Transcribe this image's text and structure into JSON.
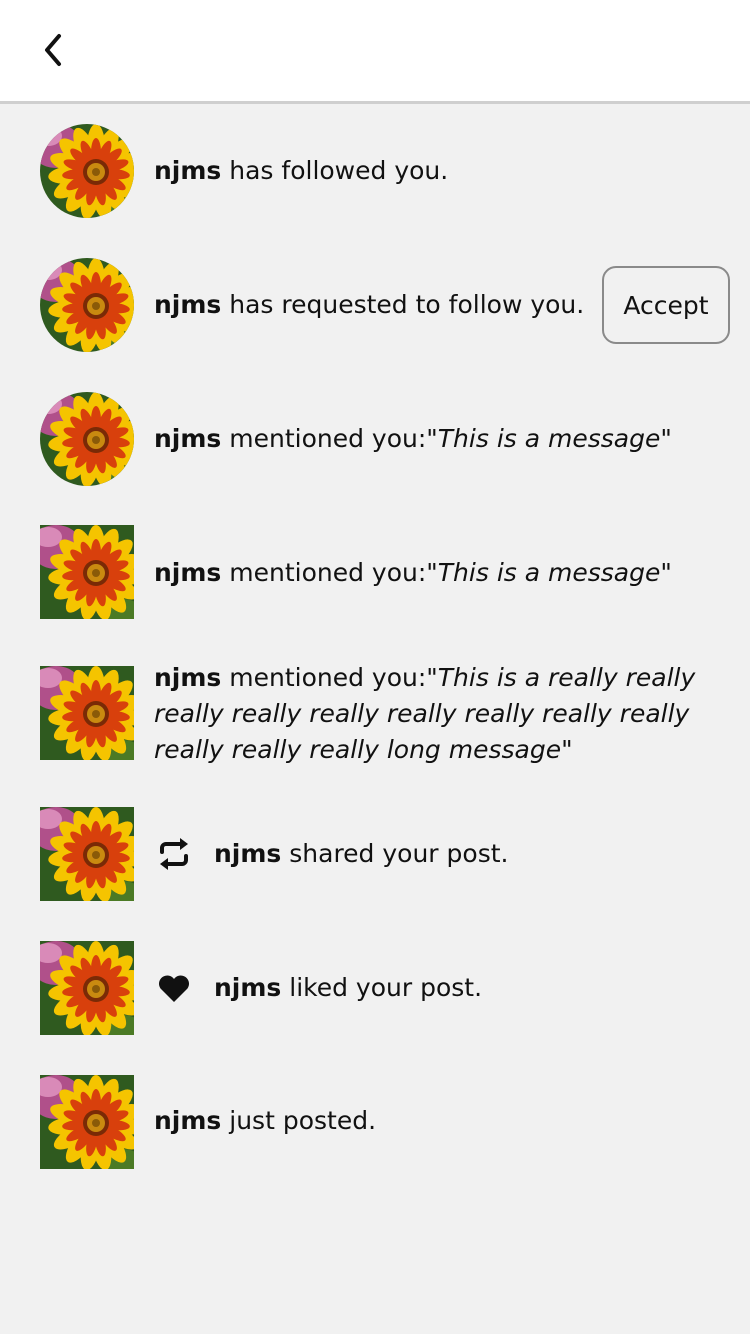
{
  "header": {
    "back_icon": "chevron-left-icon"
  },
  "colors": {
    "background": "#f1f1f1",
    "header": "#ffffff",
    "divider": "#cfcfcf",
    "text": "#111111",
    "button_border": "#8a8a8a"
  },
  "notifications": [
    {
      "avatar": "round",
      "user": "njms",
      "text": " has followed you.",
      "quote": ""
    },
    {
      "avatar": "round",
      "user": "njms",
      "text": " has requested to follow you.",
      "quote": "",
      "action_label": "Accept"
    },
    {
      "avatar": "round",
      "user": "njms",
      "text": " mentioned you:",
      "quote": "\"This is a message\""
    },
    {
      "avatar": "square",
      "user": "njms",
      "text": " mentioned you:",
      "quote": "\"This is a message\""
    },
    {
      "avatar": "square",
      "user": "njms",
      "text": " mentioned you:",
      "quote": "\"This is a really really really really really really really really really really really really long message\""
    },
    {
      "avatar": "square",
      "icon": "repost-icon",
      "user": "njms",
      "text": " shared your post.",
      "quote": ""
    },
    {
      "avatar": "square",
      "icon": "heart-icon",
      "user": "njms",
      "text": " liked your post.",
      "quote": ""
    },
    {
      "avatar": "square",
      "user": "njms",
      "text": " just posted.",
      "quote": ""
    }
  ]
}
